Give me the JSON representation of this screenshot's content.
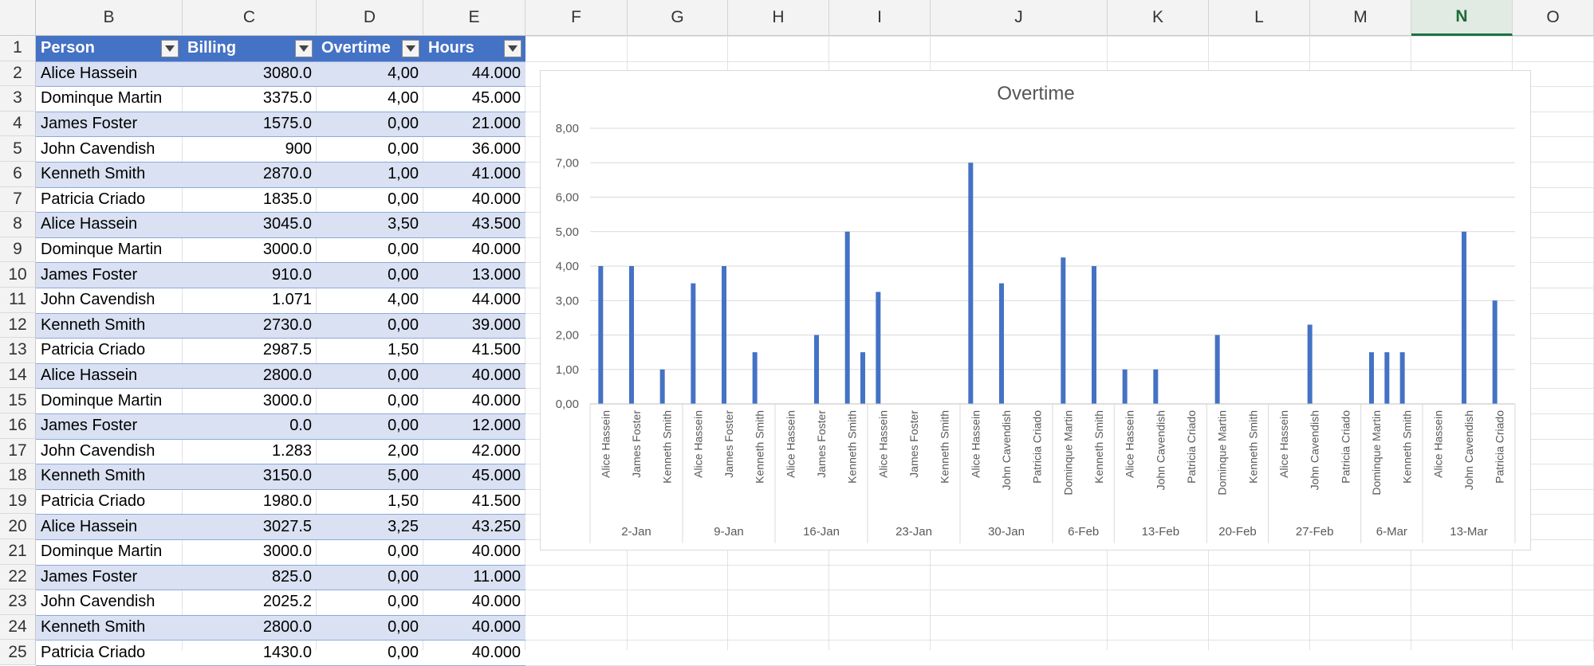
{
  "columns": [
    "B",
    "C",
    "D",
    "E",
    "F",
    "G",
    "H",
    "I",
    "J",
    "K",
    "L",
    "M",
    "N",
    "O"
  ],
  "selected_column": "N",
  "rows": [
    "1",
    "2",
    "3",
    "4",
    "5",
    "6",
    "7",
    "8",
    "9",
    "10",
    "11",
    "12",
    "13",
    "14",
    "15",
    "16",
    "17",
    "18",
    "19",
    "20",
    "21",
    "22",
    "23",
    "24",
    "25"
  ],
  "table": {
    "headers": [
      "Person",
      "Billing",
      "Overtime",
      "Hours"
    ],
    "rows": [
      [
        "Alice Hassein",
        "3080.0",
        "4,00",
        "44.000"
      ],
      [
        "Dominque Martin",
        "3375.0",
        "4,00",
        "45.000"
      ],
      [
        "James Foster",
        "1575.0",
        "0,00",
        "21.000"
      ],
      [
        "John Cavendish",
        "900",
        "0,00",
        "36.000"
      ],
      [
        "Kenneth Smith",
        "2870.0",
        "1,00",
        "41.000"
      ],
      [
        "Patricia Criado",
        "1835.0",
        "0,00",
        "40.000"
      ],
      [
        "Alice Hassein",
        "3045.0",
        "3,50",
        "43.500"
      ],
      [
        "Dominque Martin",
        "3000.0",
        "0,00",
        "40.000"
      ],
      [
        "James Foster",
        "910.0",
        "0,00",
        "13.000"
      ],
      [
        "John Cavendish",
        "1.071",
        "4,00",
        "44.000"
      ],
      [
        "Kenneth Smith",
        "2730.0",
        "0,00",
        "39.000"
      ],
      [
        "Patricia Criado",
        "2987.5",
        "1,50",
        "41.500"
      ],
      [
        "Alice Hassein",
        "2800.0",
        "0,00",
        "40.000"
      ],
      [
        "Dominque Martin",
        "3000.0",
        "0,00",
        "40.000"
      ],
      [
        "James Foster",
        "0.0",
        "0,00",
        "12.000"
      ],
      [
        "John Cavendish",
        "1.283",
        "2,00",
        "42.000"
      ],
      [
        "Kenneth Smith",
        "3150.0",
        "5,00",
        "45.000"
      ],
      [
        "Patricia Criado",
        "1980.0",
        "1,50",
        "41.500"
      ],
      [
        "Alice Hassein",
        "3027.5",
        "3,25",
        "43.250"
      ],
      [
        "Dominque Martin",
        "3000.0",
        "0,00",
        "40.000"
      ],
      [
        "James Foster",
        "825.0",
        "0,00",
        "11.000"
      ],
      [
        "John Cavendish",
        "2025.2",
        "0,00",
        "40.000"
      ],
      [
        "Kenneth Smith",
        "2800.0",
        "0,00",
        "40.000"
      ],
      [
        "Patricia Criado",
        "1430.0",
        "0,00",
        "40.000"
      ]
    ]
  },
  "chart_data": {
    "type": "bar",
    "title": "Overtime",
    "ylim": [
      0,
      8
    ],
    "yticks": [
      "0,00",
      "1,00",
      "2,00",
      "3,00",
      "4,00",
      "5,00",
      "6,00",
      "7,00",
      "8,00"
    ],
    "grid": true,
    "bar_color": "#4472c4",
    "groups": [
      {
        "label": "2-Jan",
        "items": [
          [
            "Alice Hassein",
            4.0
          ],
          [
            "James Foster",
            4.0
          ],
          [
            "Kenneth Smith",
            1.0
          ]
        ]
      },
      {
        "label": "9-Jan",
        "items": [
          [
            "Alice Hassein",
            3.5
          ],
          [
            "James Foster",
            4.0
          ],
          [
            "Kenneth Smith",
            1.5
          ]
        ]
      },
      {
        "label": "16-Jan",
        "items": [
          [
            "Alice Hassein",
            0
          ],
          [
            "James Foster",
            2.0
          ],
          [
            "Kenneth Smith",
            5.0
          ]
        ]
      },
      {
        "label": "23-Jan",
        "items": [
          [
            "Alice Hassein",
            3.25
          ],
          [
            "James Foster",
            0
          ],
          [
            "Kenneth Smith",
            0
          ]
        ]
      },
      {
        "label": "30-Jan",
        "items": [
          [
            "Alice Hassein",
            7.0
          ],
          [
            "John Cavendish",
            3.5
          ],
          [
            "Patricia Criado",
            0
          ]
        ]
      },
      {
        "label": "6-Feb",
        "items": [
          [
            "Dominque Martin",
            4.25
          ],
          [
            "Kenneth Smith",
            4.0
          ]
        ]
      },
      {
        "label": "13-Feb",
        "items": [
          [
            "Alice Hassein",
            1.0
          ],
          [
            "John Cavendish",
            1.0
          ],
          [
            "Patricia Criado",
            0
          ]
        ]
      },
      {
        "label": "20-Feb",
        "items": [
          [
            "Dominque Martin",
            2.0
          ],
          [
            "Kenneth Smith",
            0
          ]
        ]
      },
      {
        "label": "27-Feb",
        "items": [
          [
            "Alice Hassein",
            0
          ],
          [
            "John Cavendish",
            2.3
          ],
          [
            "Patricia Criado",
            0
          ]
        ]
      },
      {
        "label": "6-Mar",
        "items": [
          [
            "Dominque Martin",
            1.5
          ],
          [
            "Kenneth Smith",
            1.5
          ]
        ]
      },
      {
        "label": "13-Mar",
        "items": [
          [
            "Alice Hassein",
            0
          ],
          [
            "John Cavendish",
            5.0
          ],
          [
            "Patricia Criado",
            3.0
          ]
        ]
      }
    ],
    "extra_bars": [
      {
        "group": "16-Jan",
        "after": "Kenneth Smith",
        "value": 1.5
      },
      {
        "group": "6-Mar",
        "after": "Dominque Martin",
        "value": 1.5
      }
    ]
  }
}
